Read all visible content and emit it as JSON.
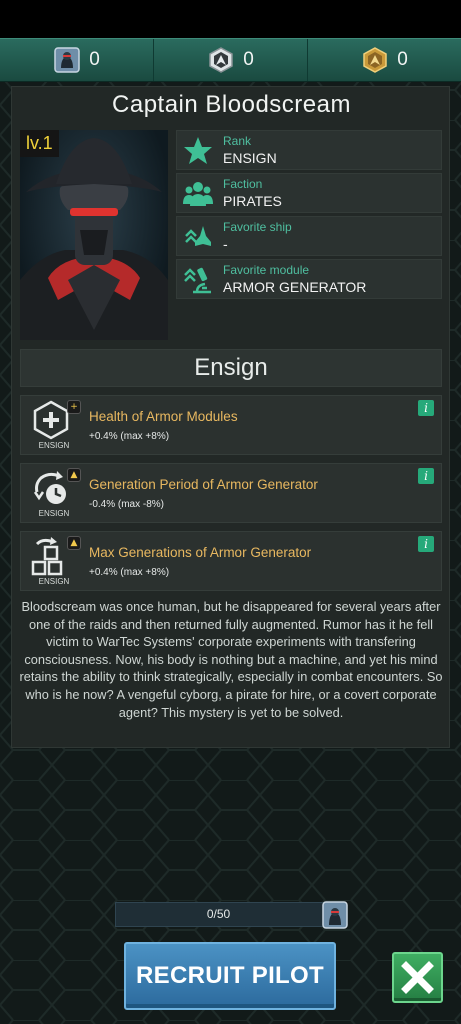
{
  "currencies": [
    {
      "icon": "pilot-card-icon",
      "value": "0"
    },
    {
      "icon": "ship-token-icon",
      "value": "0"
    },
    {
      "icon": "gold-badge-icon",
      "value": "0"
    }
  ],
  "pilot": {
    "name": "Captain Bloodscream",
    "level": "lv.1",
    "info": [
      {
        "icon": "star-icon",
        "label": "Rank",
        "value": "ENSIGN"
      },
      {
        "icon": "crew-icon",
        "label": "Faction",
        "value": "PIRATES"
      },
      {
        "icon": "ship-icon",
        "label": "Favorite ship",
        "value": "-"
      },
      {
        "icon": "microscope-icon",
        "label": "Favorite module",
        "value": "ARMOR GENERATOR"
      }
    ],
    "rank_title": "Ensign",
    "bonuses": [
      {
        "icon": "armor-plus-icon",
        "tag": "ENSIGN",
        "title": "Health of Armor Modules",
        "desc": "+0.4% (max +8%)"
      },
      {
        "icon": "generation-period-icon",
        "tag": "ENSIGN",
        "title": "Generation Period of Armor Generator",
        "desc": "-0.4% (max -8%)"
      },
      {
        "icon": "max-generations-icon",
        "tag": "ENSIGN",
        "title": "Max Generations of Armor Generator",
        "desc": "+0.4% (max +8%)"
      }
    ],
    "info_button": "i",
    "lore": "Bloodscream was once human, but he disappeared for several years after one of the raids and then returned fully augmented. Rumor has it he fell victim to WarTec Systems' corporate experiments with transfering consciousness. Now, his body is nothing but a machine, and yet his mind retains the ability to think strategically, especially in combat encounters. So who is he now? A vengeful cyborg, a pirate for hire, or a covert corporate agent? This mystery is yet to be solved."
  },
  "progress": {
    "text": "0/50",
    "fraction": 0
  },
  "buttons": {
    "recruit": "RECRUIT PILOT",
    "close_icon": "close-x-icon"
  },
  "colors": {
    "accent": "#4fbfa0",
    "bonus_title": "#e8b860",
    "level": "#f0d23a"
  }
}
